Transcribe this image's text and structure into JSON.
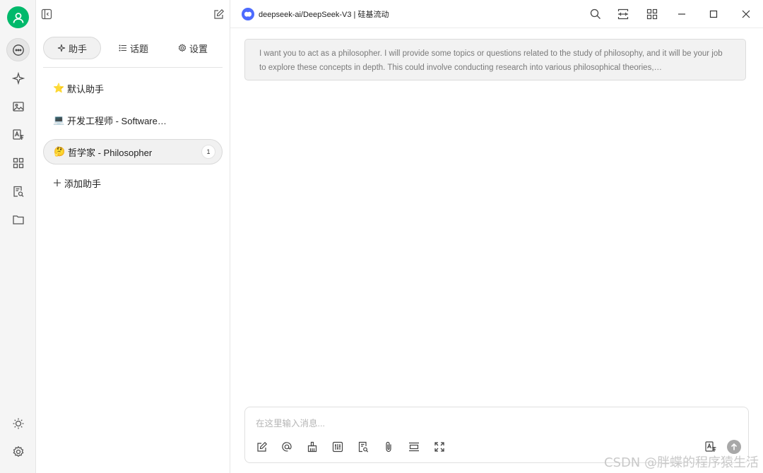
{
  "rail": {
    "accent_color": "#00b96b",
    "icons": [
      "user-icon",
      "chat-icon",
      "sparkle-icon",
      "image-icon",
      "translate-icon",
      "apps-icon",
      "file-search-icon",
      "folder-icon",
      "sun-icon",
      "settings-icon"
    ]
  },
  "panel": {
    "tabs": [
      {
        "label": "助手",
        "icon": "sparkle-icon"
      },
      {
        "label": "话题",
        "icon": "list-icon"
      },
      {
        "label": "设置",
        "icon": "gear-icon"
      }
    ],
    "assistants": [
      {
        "emoji": "⭐",
        "label": "默认助手"
      },
      {
        "emoji": "💻",
        "label": "开发工程师 - Software…"
      },
      {
        "emoji": "🤔",
        "label": "哲学家 - Philosopher",
        "count": "1"
      }
    ],
    "add_label": "添加助手"
  },
  "header": {
    "model_title": "deepseek-ai/DeepSeek-V3 | 硅基流动"
  },
  "chat": {
    "system_prompt": "I want you to act as a philosopher. I will provide some topics or questions related to the study of philosophy, and it will be your job to explore these concepts in depth. This could involve conducting research into various philosophical theories,…"
  },
  "composer": {
    "placeholder": "在这里输入消息..."
  },
  "watermark": "CSDN @胖蝶的程序猿生活"
}
